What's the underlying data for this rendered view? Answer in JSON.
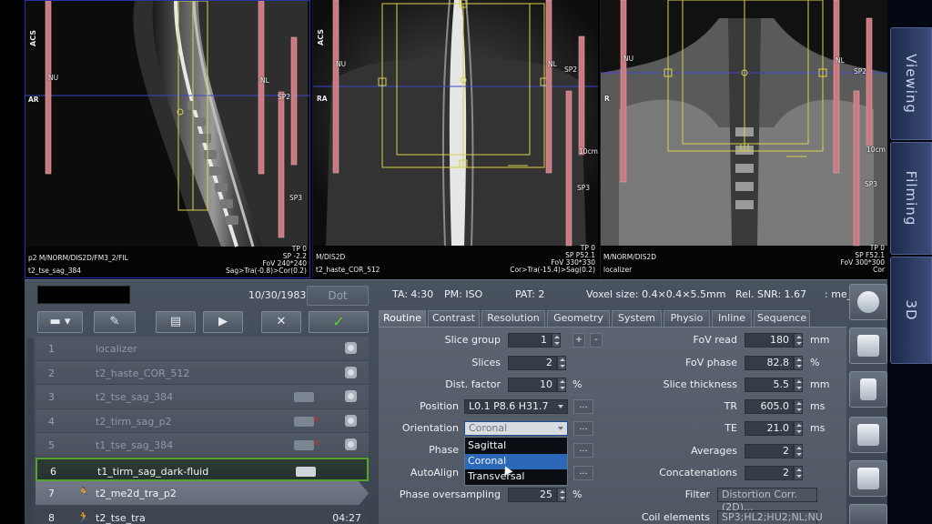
{
  "viewports": [
    {
      "id": "vp1",
      "orient_top": "ACS",
      "orient_left": "AR",
      "labels": [
        "NU",
        "NL",
        "SP2",
        "SP3"
      ],
      "bottom_left": [
        "p2 M/NORM/DIS2D/FM3_2/FIL",
        "t2_tse_sag_384"
      ],
      "bottom_right": [
        "TP 0",
        "SP -2.2",
        "FoV 240*240",
        "Sag>Tra(-0.8)>Cor(0.2)"
      ]
    },
    {
      "id": "vp2",
      "orient_top": "ACS",
      "orient_left": "RA",
      "labels": [
        "NU",
        "NL",
        "SP2",
        "SP3",
        "10cm"
      ],
      "bottom_left": [
        "M/DIS2D",
        "t2_haste_COR_512"
      ],
      "bottom_right": [
        "TP 0",
        "SP P52.1",
        "FoV 330*330",
        "Cor>Tra(-15.4)>Sag(0.2)"
      ]
    },
    {
      "id": "vp3",
      "orient_top": "",
      "orient_left": "R",
      "labels": [
        "NU",
        "NL",
        "SP2",
        "SP3",
        "10cm"
      ],
      "bottom_left": [
        "M/NORM/DIS2D",
        "localizer"
      ],
      "bottom_right": [
        "TP 0",
        "SP F52.1",
        "FoV 300*300",
        "Cor"
      ]
    }
  ],
  "side_tabs": [
    "Viewing",
    "Filming",
    "3D"
  ],
  "header": {
    "date": "10/30/1983",
    "dot_label": "Dot"
  },
  "toolbar": {
    "menu_label": "▬ ▾",
    "pen_label": "✎",
    "folder_label": "▤",
    "play_label": "▶",
    "cancel_label": "✕",
    "apply_label": "✓"
  },
  "protocols": [
    {
      "num": "1",
      "name": "localizer"
    },
    {
      "num": "2",
      "name": "t2_haste_COR_512"
    },
    {
      "num": "3",
      "name": "t2_tse_sag_384"
    },
    {
      "num": "4",
      "name": "t2_tirm_sag_p2"
    },
    {
      "num": "5",
      "name": "t1_tse_sag_384"
    },
    {
      "num": "6",
      "name": "t1_tirm_sag_dark-fluid"
    },
    {
      "num": "7",
      "name": "t2_me2d_tra_p2"
    },
    {
      "num": "8",
      "name": "t2_tse_tra",
      "time": "04:27"
    }
  ],
  "info_bar": {
    "ta": "TA: 4:30",
    "pm": "PM: ISO",
    "pat": "PAT: 2",
    "voxel": "Voxel size: 0.4×0.4×5.5mm",
    "snr": "Rel. SNR: 1.67",
    "seq": ": me_r"
  },
  "tabs": [
    "Routine",
    "Contrast",
    "Resolution",
    "Geometry",
    "System",
    "Physio",
    "Inline",
    "Sequence"
  ],
  "params_left": {
    "slice_group": {
      "label": "Slice group",
      "value": "1"
    },
    "slices": {
      "label": "Slices",
      "value": "2"
    },
    "dist_factor": {
      "label": "Dist. factor",
      "value": "10",
      "unit": "%"
    },
    "position": {
      "label": "Position",
      "value": "L0.1 P8.6 H31.7"
    },
    "orientation": {
      "label": "Orientation",
      "value": "Coronal"
    },
    "phase": {
      "label": "Phase"
    },
    "autoalign": {
      "label": "AutoAlign"
    },
    "phase_oversampling": {
      "label": "Phase oversampling",
      "value": "25",
      "unit": "%"
    }
  },
  "orientation_options": [
    "Sagittal",
    "Coronal",
    "Transversal"
  ],
  "params_right": {
    "fov_read": {
      "label": "FoV read",
      "value": "180",
      "unit": "mm"
    },
    "fov_phase": {
      "label": "FoV phase",
      "value": "82.8",
      "unit": "%"
    },
    "slice_thickness": {
      "label": "Slice thickness",
      "value": "5.5",
      "unit": "mm"
    },
    "tr": {
      "label": "TR",
      "value": "605.0",
      "unit": "ms"
    },
    "te": {
      "label": "TE",
      "value": "21.0",
      "unit": "ms"
    },
    "averages": {
      "label": "Averages",
      "value": "2"
    },
    "concatenations": {
      "label": "Concatenations",
      "value": "2"
    },
    "filter": {
      "label": "Filter",
      "value": "Distortion Corr.(2D)..."
    },
    "coil_elements": {
      "label": "Coil elements",
      "value": "SP3;HL2;HU2;NL;NU"
    }
  },
  "colors": {
    "accent_green": "#5aa02c",
    "selection_blue": "#2b69b8",
    "saturation_band": "#c97a80",
    "fov_box": "#d8d24a"
  }
}
